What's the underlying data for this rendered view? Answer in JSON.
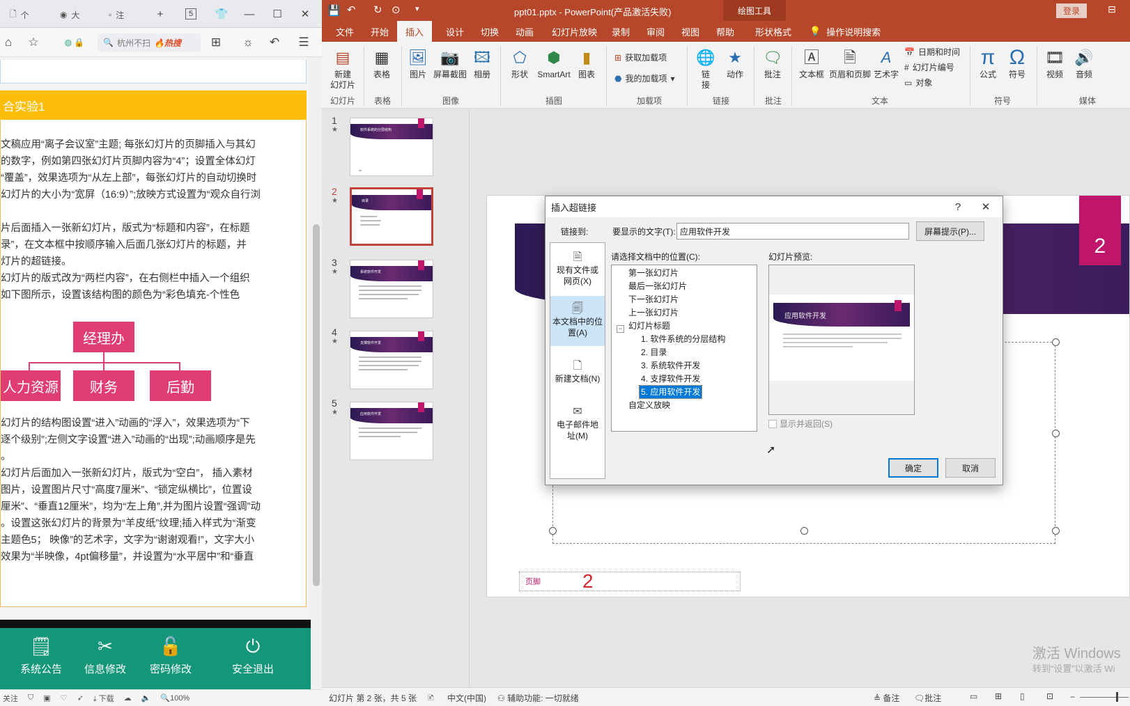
{
  "browser": {
    "tabs": [
      {
        "label": "个"
      },
      {
        "label": "大"
      },
      {
        "label": "注"
      }
    ],
    "tab_count_badge": "5",
    "address_text": "杭州不扫",
    "address_hot": "热搜",
    "exercise_title": "合实验1",
    "paragraphs": [
      "文稿应用“离子会议室”主题; 每张幻灯片的页脚插入与其幻",
      "的数字，例如第四张幻灯片页脚内容为“4”；设置全体幻灯",
      "“覆盖”，效果选项为“从左上部”，每张幻灯片的自动切换时",
      "幻灯片的大小为“宽屏（16:9）”;放映方式设置为“观众自行浏",
      "",
      "片后面插入一张新幻灯片，版式为“标题和内容”，在标题",
      "录”，在文本框中按顺序输入后面几张幻灯片的标题，并",
      "灯片的超链接。",
      "幻灯片的版式改为“两栏内容”，在右侧栏中插入一个组织",
      "如下图所示，设置该结构图的颜色为“彩色填充-个性色"
    ],
    "org_chart": {
      "top": "经理办",
      "children": [
        "人力资源",
        "财务",
        "后勤"
      ]
    },
    "paragraphs2": [
      "幻灯片的结构图设置“进入”动画的“浮入”，效果选项为“下",
      "逐个级别”;左侧文字设置“进入”动画的“出现”;动画顺序是先",
      "。",
      "幻灯片后面加入一张新幻灯片，版式为“空白”， 插入素材",
      "图片，设置图片尺寸“高度7厘米”、“锁定纵横比”，位置设",
      "厘米”、“垂直12厘米”，均为“左上角”,并为图片设置“强调”动",
      "。设置这张幻灯片的背景为“羊皮纸”纹理;插入样式为“渐变",
      "主题色5； 映像”的艺术字，文字为“谢谢观看!”，文字大小",
      "效果为“半映像，4pt偏移量”，并设置为“水平居中”和“垂直"
    ],
    "bottom_buttons": [
      {
        "label": "系统公告",
        "icon": "notice-icon"
      },
      {
        "label": "信息修改",
        "icon": "tools-icon"
      },
      {
        "label": "密码修改",
        "icon": "lock-icon"
      },
      {
        "label": "安全退出",
        "icon": "power-icon"
      }
    ],
    "status": {
      "follow": "关注",
      "download": "下载",
      "zoom": "100%"
    }
  },
  "ppt": {
    "title": "ppt01.pptx  -  PowerPoint(产品激活失败)",
    "context_tab": "绘图工具",
    "login": "登录",
    "tabs": [
      "文件",
      "开始",
      "插入",
      "设计",
      "切换",
      "动画",
      "幻灯片放映",
      "录制",
      "审阅",
      "视图",
      "帮助",
      "形状格式"
    ],
    "active_tab": "插入",
    "search": "操作说明搜索",
    "ribbon": {
      "new_slide": "新建\n幻灯片",
      "table": "表格",
      "picture": "图片",
      "screenshot": "屏幕截图",
      "album": "相册",
      "shapes": "形状",
      "smartart": "SmartArt",
      "chart": "图表",
      "get_addins": "获取加载项",
      "my_addins": "我的加载项",
      "link": "链\n接",
      "action": "动作",
      "comment": "批注",
      "textbox": "文本框",
      "header_footer": "页眉和页脚",
      "wordart": "艺术字",
      "datetime": "日期和时间",
      "slide_number": "幻灯片编号",
      "object": "对象",
      "equation": "公式",
      "symbol": "符号",
      "video": "视频",
      "audio": "音频",
      "groups": [
        "幻灯片",
        "表格",
        "图像",
        "插图",
        "加载项",
        "链接",
        "批注",
        "文本",
        "符号",
        "媒体"
      ]
    },
    "thumbnails": [
      {
        "num": "1",
        "title": "软件系统的分层结构"
      },
      {
        "num": "2",
        "title": "目录"
      },
      {
        "num": "3",
        "title": "系统软件开发"
      },
      {
        "num": "4",
        "title": "支撑软件开发"
      },
      {
        "num": "5",
        "title": "应用软件开发"
      }
    ],
    "slide_tag_number": "2",
    "footer_label": "页脚",
    "footer_number": "2",
    "status": {
      "slide_info": "幻灯片 第 2 张，共 5 张",
      "language": "中文(中国)",
      "accessibility": "辅助功能: 一切就绪",
      "notes": "备注",
      "comments": "批注"
    },
    "watermark_1": "激活 Windows",
    "watermark_2": "转到“设置”以激活 Wi"
  },
  "dialog": {
    "title": "插入超链接",
    "help": "?",
    "link_to_label": "链接到:",
    "link_options": [
      {
        "label": "现有文件或网页(X)",
        "icon": "web-page-icon"
      },
      {
        "label": "本文档中的位置(A)",
        "icon": "document-place-icon"
      },
      {
        "label": "新建文档(N)",
        "icon": "new-document-icon"
      },
      {
        "label": "电子邮件地址(M)",
        "icon": "email-icon"
      }
    ],
    "display_text_label": "要显示的文字(T):",
    "display_text_value": "应用软件开发",
    "screentip_button": "屏幕提示(P)...",
    "place_label": "请选择文档中的位置(C):",
    "preview_label": "幻灯片预览:",
    "tree": [
      "第一张幻灯片",
      "最后一张幻灯片",
      "下一张幻灯片",
      "上一张幻灯片",
      "幻灯片标题",
      "1. 软件系统的分层结构",
      "2. 目录",
      "3. 系统软件开发",
      "4. 支撑软件开发",
      "5. 应用软件开发",
      "自定义放映"
    ],
    "preview_title": "应用软件开发",
    "show_and_return": "显示并返回(S)",
    "ok": "确定",
    "cancel": "取消"
  }
}
